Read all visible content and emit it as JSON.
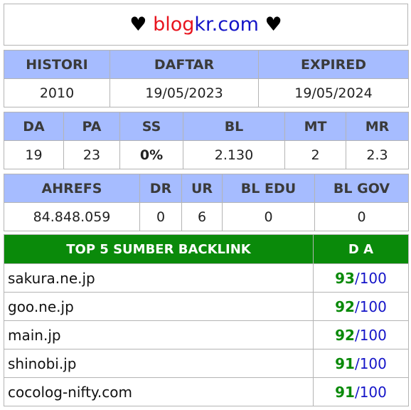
{
  "title": {
    "heart_left": "♥",
    "name_part1": "blog",
    "name_part2": "kr.com",
    "heart_right": "♥"
  },
  "domain_info": {
    "headers": [
      "HISTORI",
      "DAFTAR",
      "EXPIRED"
    ],
    "values": [
      "2010",
      "19/05/2023",
      "19/05/2024"
    ]
  },
  "metrics": {
    "headers": [
      "DA",
      "PA",
      "SS",
      "BL",
      "MT",
      "MR"
    ],
    "values": [
      "19",
      "23",
      "0%",
      "2.130",
      "2",
      "2.3"
    ]
  },
  "ahrefs": {
    "headers": [
      "AHREFS",
      "DR",
      "UR",
      "BL EDU",
      "BL GOV"
    ],
    "values": [
      "84.848.059",
      "0",
      "6",
      "0",
      "0"
    ]
  },
  "backlinks": {
    "header_source": "TOP 5 SUMBER BACKLINK",
    "header_da": "D A",
    "separator": "/",
    "rows": [
      {
        "site": "sakura.ne.jp",
        "da": "93",
        "max": "100"
      },
      {
        "site": "goo.ne.jp",
        "da": "92",
        "max": "100"
      },
      {
        "site": "main.jp",
        "da": "92",
        "max": "100"
      },
      {
        "site": "shinobi.jp",
        "da": "91",
        "max": "100"
      },
      {
        "site": "cocolog-nifty.com",
        "da": "91",
        "max": "100"
      }
    ]
  },
  "colors": {
    "header_blue": "#a6bcff",
    "header_green": "#0a8a0a",
    "brand_red": "#e8141e",
    "brand_blue": "#1414c8",
    "ss_green": "#7ad31e"
  }
}
